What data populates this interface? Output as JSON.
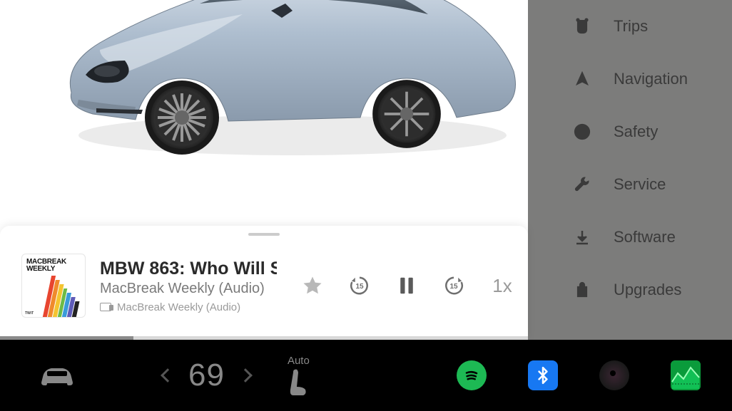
{
  "sidebar": {
    "items": [
      {
        "label": "Trips",
        "icon": "trips-icon"
      },
      {
        "label": "Navigation",
        "icon": "navigation-icon"
      },
      {
        "label": "Safety",
        "icon": "safety-icon"
      },
      {
        "label": "Service",
        "icon": "service-icon"
      },
      {
        "label": "Software",
        "icon": "software-icon"
      },
      {
        "label": "Upgrades",
        "icon": "upgrades-icon"
      }
    ]
  },
  "media": {
    "track_title": "MBW 863: Who Will S",
    "artist": "MacBreak Weekly (Audio)",
    "source": "MacBreak Weekly (Audio)",
    "album_art_line1": "MACBREAK",
    "album_art_line2": "WEEKLY",
    "album_art_corner": "TWiT",
    "playback_speed": "1x",
    "progress_percent": 25.3
  },
  "climate": {
    "temperature": "69",
    "seat_mode": "Auto"
  },
  "colors": {
    "spotify": "#1DB954",
    "bluetooth": "#1778F2",
    "energy": "#0a9b3b"
  }
}
